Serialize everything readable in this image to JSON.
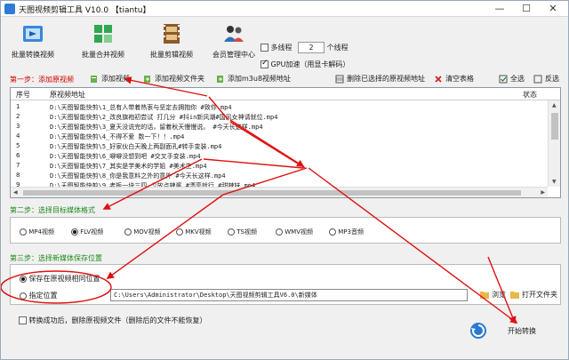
{
  "window": {
    "title": "天图视频剪辑工具 V10.0 【tiantu】",
    "minimize": "—",
    "maximize": "☐",
    "close": "✕"
  },
  "toolbar": {
    "buttons": [
      {
        "label": "批量转换视频",
        "icon": "film-convert-icon"
      },
      {
        "label": "批量合并视频",
        "icon": "merge-grid-icon"
      },
      {
        "label": "批量剪辑视频",
        "icon": "film-edit-icon"
      },
      {
        "label": "会员管理中心",
        "icon": "users-icon"
      }
    ],
    "multithread_label": "多线程",
    "thread_count": "2",
    "thread_unit": "个线程",
    "gpu_label": "GPU加速（用显卡解码）",
    "multithread_checked": false,
    "gpu_checked": true
  },
  "step1": {
    "title": "第一步：添加原视频",
    "actions": {
      "add_video": "添加视频",
      "add_folder": "添加视频文件夹",
      "add_url": "添加m3u8视频地址",
      "delete_selected": "删除已选择的原视频地址",
      "clear_table": "清空表格",
      "select_all": "全选",
      "invert_select": "反选"
    }
  },
  "table": {
    "col_no": "序号",
    "col_path": "原视频地址",
    "col_status": "状态",
    "rows": [
      {
        "no": "1",
        "path": "D:\\天图智能快剪\\1_总有人带着热衷与坚定去拥抱你  #致你.mp4"
      },
      {
        "no": "2",
        "path": "D:\\天图智能快剪\\2_改良旗袍初尝试 打几分  #抖in新风潮#国风女神请就位.mp4"
      },
      {
        "no": "3",
        "path": "D:\\天图智能快剪\\3_夏天没说完的话，留着秋天慢慢说。  #今天长这样.mp4"
      },
      {
        "no": "4",
        "path": "D:\\天图智能快剪\\4_不得不爱 数一下！！.mp4"
      },
      {
        "no": "5",
        "path": "D:\\天图智能快剪\\5_好家伙白天晚上两副面孔#转手变装.mp4"
      },
      {
        "no": "6",
        "path": "D:\\天图智能快剪\\6_噼噼没想到吧 #交叉手变装.mp4"
      },
      {
        "no": "7",
        "path": "D:\\天图智能快剪\\7_其实是学美术的学姐 #美术生.mp4"
      },
      {
        "no": "8",
        "path": "D:\\天图智能快剪\\8_你是我意料之外的意外  #今天长这样.mp4"
      },
      {
        "no": "9",
        "path": "D:\\天图智能快剪\\9_老板一块三四 少放点辣酱  #漂亮就行 #甜辣妹.mp4"
      }
    ]
  },
  "step2": {
    "title": "第二步：选择目标媒体格式",
    "formats": [
      "MP4视频",
      "FLV视频",
      "MOV视频",
      "MKV视频",
      "TS视频",
      "WMV视频",
      "MP3音频"
    ],
    "selected_index": 1
  },
  "step3": {
    "title": "第三步：选择新媒体保存位置",
    "same_location": "保存在原视频相同位置",
    "custom_location": "指定位置",
    "path_value": "C:\\Users\\Administrator\\Desktop\\天图视频剪辑工具V6.0\\新媒体",
    "browse": "浏览",
    "open_folder": "打开文件夹"
  },
  "footer": {
    "delete_after": "转换成功后，删除原视频文件（删除后的文件不能恢复）",
    "start": "开始转换"
  },
  "colors": {
    "step_green": "#1a8a1a",
    "step_red": "#d40000",
    "annotation_red": "#e01010"
  }
}
